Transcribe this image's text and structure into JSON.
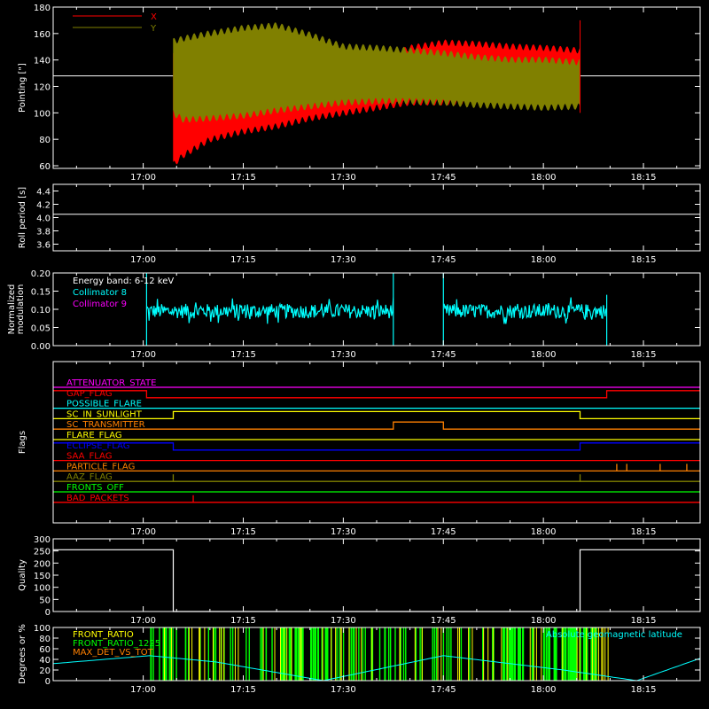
{
  "time_axis": {
    "ticks": [
      "17:00",
      "17:15",
      "17:30",
      "17:45",
      "18:00",
      "18:15"
    ],
    "tick_minutes": [
      0,
      15,
      30,
      45,
      60,
      75
    ],
    "range_minutes": [
      -13.5,
      83.5
    ]
  },
  "colors": {
    "background": "#000000",
    "axes": "#ffffff",
    "red": "#ff0000",
    "olive": "#808000",
    "cyan": "#00ffff",
    "magenta": "#ff00ff",
    "yellow": "#ffff00",
    "green": "#00ff00",
    "orange": "#ff8000",
    "blue": "#0000ff",
    "white": "#ffffff"
  },
  "chart_data": [
    {
      "id": "pointing",
      "type": "area",
      "ylabel": "Pointing [\"]",
      "ylim": [
        58,
        180
      ],
      "yticks": [
        60,
        80,
        100,
        120,
        140,
        160,
        180
      ],
      "legend": [
        "X",
        "Y"
      ],
      "reference_line": 128,
      "data_start_minutes": 4.5,
      "data_end_minutes": 65.5,
      "series": [
        {
          "name": "X",
          "color": "#ff0000",
          "x": [
            4.5,
            6,
            10,
            15,
            20,
            25,
            30,
            35,
            40,
            45,
            50,
            55,
            60,
            65.5
          ],
          "upper": [
            145,
            142,
            133,
            128,
            128,
            132,
            134,
            138,
            149,
            153,
            152,
            150,
            149,
            147
          ],
          "lower": [
            61,
            68,
            80,
            86,
            90,
            96,
            100,
            104,
            108,
            108,
            109,
            109,
            109,
            108
          ]
        },
        {
          "name": "Y",
          "color": "#808000",
          "x": [
            4.5,
            6,
            10,
            15,
            20,
            25,
            30,
            35,
            40,
            45,
            50,
            55,
            60,
            65.5
          ],
          "upper": [
            154,
            156,
            160,
            164,
            166,
            159,
            150,
            149,
            147,
            145,
            142,
            140,
            140,
            138
          ],
          "lower": [
            100,
            95,
            96,
            98,
            102,
            105,
            108,
            109,
            109,
            108,
            106,
            105,
            104,
            105
          ]
        }
      ]
    },
    {
      "id": "roll",
      "type": "line",
      "ylabel": "Roll period [s]",
      "ylim": [
        3.5,
        4.5
      ],
      "yticks": [
        "3.6",
        "3.8",
        "4.0",
        "4.2",
        "4.4"
      ],
      "series": [
        {
          "color": "#ffffff",
          "x": [
            -13.5,
            83.5
          ],
          "y": [
            4.05,
            4.05
          ]
        }
      ]
    },
    {
      "id": "modulation",
      "type": "line",
      "ylabel": "Normalized modulation",
      "ylim": [
        0,
        0.2
      ],
      "yticks": [
        "0.00",
        "0.05",
        "0.10",
        "0.15",
        "0.20"
      ],
      "annotations": [
        "Energy band: 6-12 keV",
        "Collimator 8",
        "Collimator 9"
      ],
      "series": [
        {
          "name": "Collimator 8",
          "color": "#00ffff",
          "segments": [
            [
              0.5,
              37.5
            ],
            [
              45,
              69.5
            ]
          ],
          "level": 0.095,
          "noise": 0.02
        },
        {
          "name": "Collimator 9",
          "color": "#ff00ff",
          "x": [
            -13.5,
            83.5
          ],
          "y": [
            0,
            0
          ]
        }
      ]
    },
    {
      "id": "flags",
      "type": "line",
      "ylabel": "Flags",
      "rows": [
        {
          "label": "ATTENUATOR_STATE",
          "color": "#ff00ff",
          "steps": [
            [
              -13.5,
              0
            ]
          ]
        },
        {
          "label": "GAP_FLAG",
          "color": "#ff0000",
          "steps": [
            [
              -13.5,
              1
            ],
            [
              0.5,
              0
            ],
            [
              69.5,
              1
            ]
          ]
        },
        {
          "label": "POSSIBLE_FLARE",
          "color": "#00ffff",
          "steps": [
            [
              -13.5,
              0
            ]
          ]
        },
        {
          "label": "SC_IN_SUNLIGHT",
          "color": "#ffff00",
          "steps": [
            [
              -13.5,
              0
            ],
            [
              4.5,
              1
            ],
            [
              65.5,
              0
            ]
          ]
        },
        {
          "label": "SC_TRANSMITTER",
          "color": "#ff8000",
          "steps": [
            [
              -13.5,
              0
            ],
            [
              37.5,
              1
            ],
            [
              45,
              0
            ]
          ]
        },
        {
          "label": "FLARE_FLAG",
          "color": "#ffff00",
          "steps": [
            [
              -13.5,
              0
            ]
          ]
        },
        {
          "label": "ECLIPSE_FLAG",
          "color": "#0000ff",
          "steps": [
            [
              -13.5,
              1
            ],
            [
              4.5,
              0
            ],
            [
              65.5,
              1
            ]
          ]
        },
        {
          "label": "SAA_FLAG",
          "color": "#ff0000",
          "steps": [
            [
              -13.5,
              0
            ]
          ]
        },
        {
          "label": "PARTICLE_FLAG",
          "color": "#ff8000",
          "steps": [
            [
              -13.5,
              0
            ]
          ],
          "spikes": [
            71,
            72.5,
            77.5,
            81.5,
            84
          ]
        },
        {
          "label": "AAZ_FLAG",
          "color": "#808000",
          "steps": [
            [
              -13.5,
              0
            ]
          ],
          "spikes": [
            4.5,
            65.5
          ]
        },
        {
          "label": "FRONTS_OFF",
          "color": "#00ff00",
          "steps": [
            [
              -13.5,
              0
            ]
          ]
        },
        {
          "label": "BAD_PACKETS",
          "color": "#ff0000",
          "steps": [
            [
              -13.5,
              0
            ]
          ],
          "spikes": [
            7.5
          ]
        }
      ]
    },
    {
      "id": "quality",
      "type": "line",
      "ylabel": "Quality",
      "ylim": [
        0,
        300
      ],
      "yticks": [
        "0",
        "50",
        "100",
        "150",
        "200",
        "250",
        "300"
      ],
      "series": [
        {
          "color": "#ffffff",
          "x": [
            -13.5,
            4.5,
            4.5,
            65.5,
            65.5,
            83.5
          ],
          "y": [
            255,
            255,
            0,
            0,
            255,
            255
          ]
        }
      ]
    },
    {
      "id": "geomag",
      "type": "line",
      "ylabel": "Degrees or %",
      "ylim": [
        0,
        100
      ],
      "yticks": [
        "0",
        "20",
        "40",
        "60",
        "80",
        "100"
      ],
      "legend": [
        "FRONT_RATIO",
        "FRONT_RATIO_1225",
        "MAX_DET_VS_TOT"
      ],
      "legend_right": "Absolute geomagnetic latitude",
      "series": [
        {
          "name": "Absolute geomagnetic latitude",
          "color": "#00ffff",
          "x": [
            -13.5,
            1,
            11,
            27,
            45,
            63,
            74,
            83.5
          ],
          "y": [
            32,
            47,
            35,
            0,
            47,
            20,
            0,
            42
          ]
        },
        {
          "name": "FRONT_RATIO_1225",
          "color": "#00ff00",
          "range": [
            1,
            70
          ]
        },
        {
          "name": "FRONT_RATIO",
          "color": "#ffff00",
          "range": [
            1,
            70
          ]
        }
      ]
    }
  ]
}
